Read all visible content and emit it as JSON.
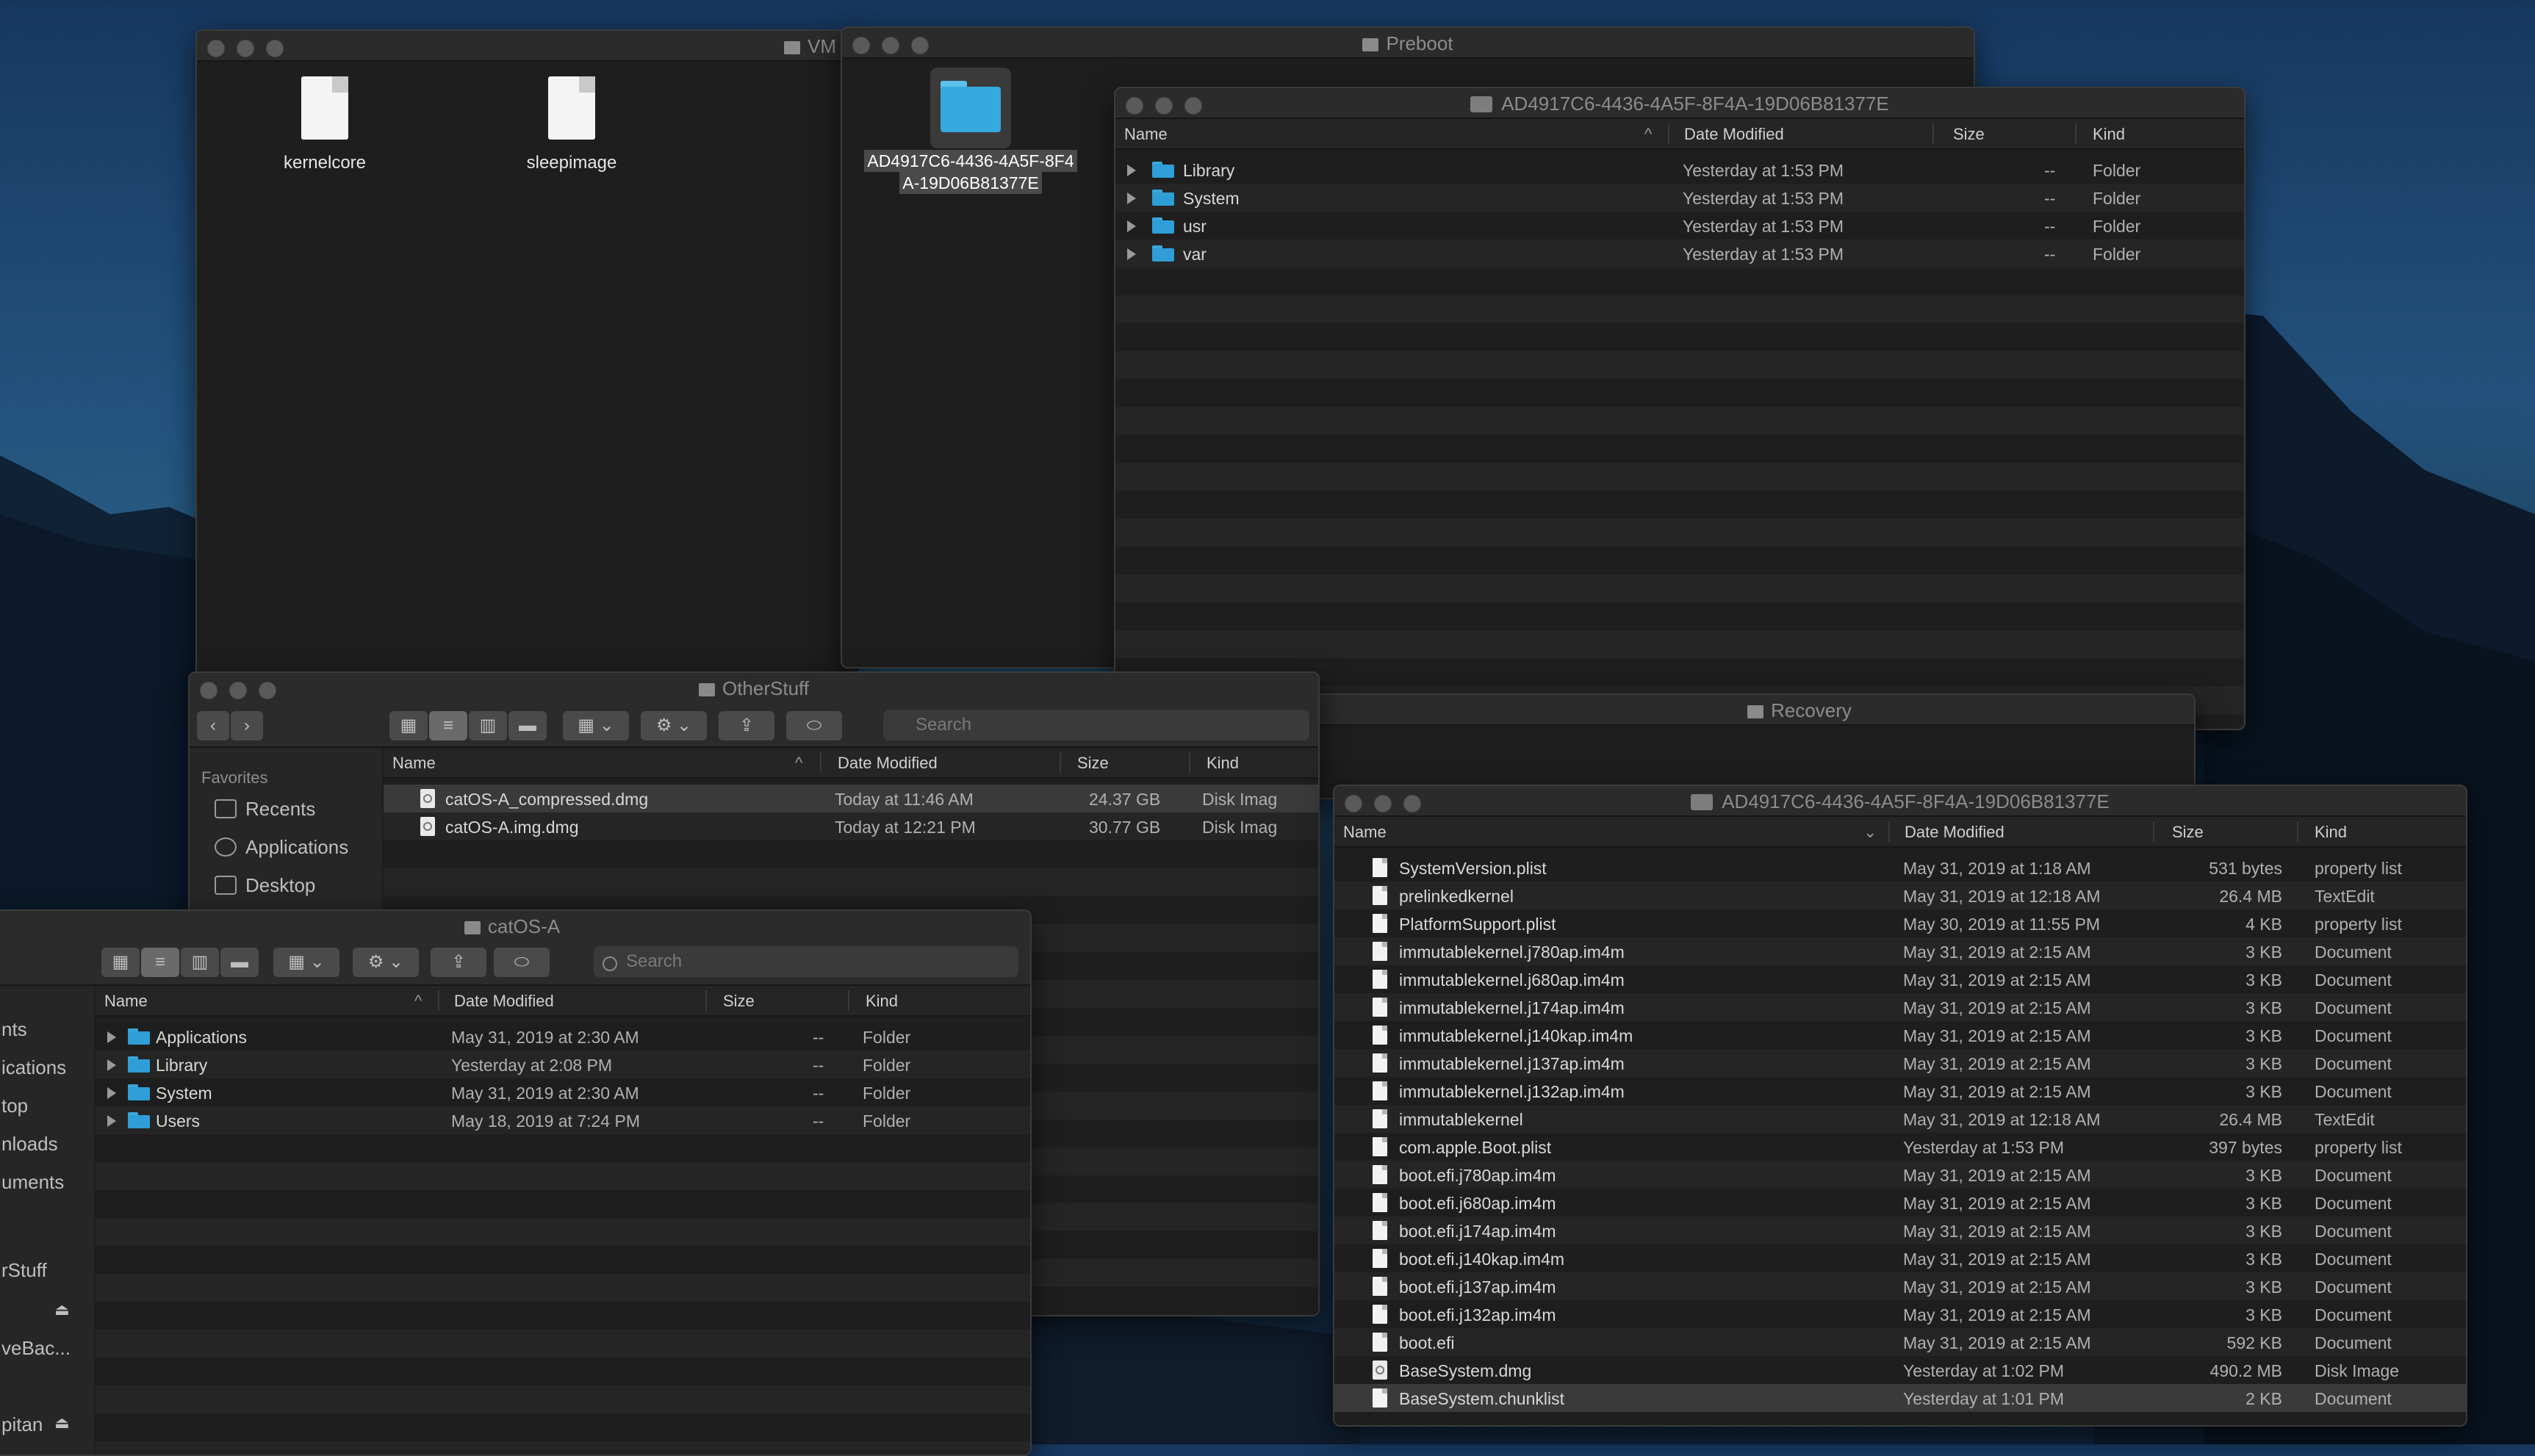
{
  "colors": {
    "folder": "#2f9ed6",
    "window_bg": "#1e1e1e",
    "titlebar": "#2b2b2b",
    "selected_row": "#3a3a3a"
  },
  "windows": {
    "vm": {
      "title": "VM",
      "icons": [
        {
          "label": "kernelcore"
        },
        {
          "label": "sleepimage"
        }
      ]
    },
    "preboot": {
      "title": "Preboot",
      "folder_label_line1": "AD4917C6-4436-4A5F-8F4",
      "folder_label_line2": "A-19D06B81377E"
    },
    "ad_top": {
      "title": "AD4917C6-4436-4A5F-8F4A-19D06B81377E",
      "columns": {
        "name": "Name",
        "date": "Date Modified",
        "size": "Size",
        "kind": "Kind"
      },
      "rows": [
        {
          "name": "Library",
          "date": "Yesterday at 1:53 PM",
          "size": "--",
          "kind": "Folder"
        },
        {
          "name": "System",
          "date": "Yesterday at 1:53 PM",
          "size": "--",
          "kind": "Folder"
        },
        {
          "name": "usr",
          "date": "Yesterday at 1:53 PM",
          "size": "--",
          "kind": "Folder"
        },
        {
          "name": "var",
          "date": "Yesterday at 1:53 PM",
          "size": "--",
          "kind": "Folder"
        }
      ]
    },
    "otherstuff": {
      "title": "OtherStuff",
      "search_placeholder": "Search",
      "sidebar": {
        "heading": "Favorites",
        "items": [
          "Recents",
          "Applications",
          "Desktop"
        ]
      },
      "columns": {
        "name": "Name",
        "date": "Date Modified",
        "size": "Size",
        "kind": "Kind"
      },
      "rows": [
        {
          "name": "catOS-A_compressed.dmg",
          "date": "Today at 11:46 AM",
          "size": "24.37 GB",
          "kind": "Disk Imag"
        },
        {
          "name": "catOS-A.img.dmg",
          "date": "Today at 12:21 PM",
          "size": "30.77 GB",
          "kind": "Disk Imag"
        }
      ]
    },
    "recovery": {
      "title": "Recovery"
    },
    "ad_bottom": {
      "title": "AD4917C6-4436-4A5F-8F4A-19D06B81377E",
      "columns": {
        "name": "Name",
        "date": "Date Modified",
        "size": "Size",
        "kind": "Kind"
      },
      "rows": [
        {
          "name": "SystemVersion.plist",
          "date": "May 31, 2019 at 1:18 AM",
          "size": "531 bytes",
          "kind": "property list"
        },
        {
          "name": "prelinkedkernel",
          "date": "May 31, 2019 at 12:18 AM",
          "size": "26.4 MB",
          "kind": "TextEdit"
        },
        {
          "name": "PlatformSupport.plist",
          "date": "May 30, 2019 at 11:55 PM",
          "size": "4 KB",
          "kind": "property list"
        },
        {
          "name": "immutablekernel.j780ap.im4m",
          "date": "May 31, 2019 at 2:15 AM",
          "size": "3 KB",
          "kind": "Document"
        },
        {
          "name": "immutablekernel.j680ap.im4m",
          "date": "May 31, 2019 at 2:15 AM",
          "size": "3 KB",
          "kind": "Document"
        },
        {
          "name": "immutablekernel.j174ap.im4m",
          "date": "May 31, 2019 at 2:15 AM",
          "size": "3 KB",
          "kind": "Document"
        },
        {
          "name": "immutablekernel.j140kap.im4m",
          "date": "May 31, 2019 at 2:15 AM",
          "size": "3 KB",
          "kind": "Document"
        },
        {
          "name": "immutablekernel.j137ap.im4m",
          "date": "May 31, 2019 at 2:15 AM",
          "size": "3 KB",
          "kind": "Document"
        },
        {
          "name": "immutablekernel.j132ap.im4m",
          "date": "May 31, 2019 at 2:15 AM",
          "size": "3 KB",
          "kind": "Document"
        },
        {
          "name": "immutablekernel",
          "date": "May 31, 2019 at 12:18 AM",
          "size": "26.4 MB",
          "kind": "TextEdit"
        },
        {
          "name": "com.apple.Boot.plist",
          "date": "Yesterday at 1:53 PM",
          "size": "397 bytes",
          "kind": "property list"
        },
        {
          "name": "boot.efi.j780ap.im4m",
          "date": "May 31, 2019 at 2:15 AM",
          "size": "3 KB",
          "kind": "Document"
        },
        {
          "name": "boot.efi.j680ap.im4m",
          "date": "May 31, 2019 at 2:15 AM",
          "size": "3 KB",
          "kind": "Document"
        },
        {
          "name": "boot.efi.j174ap.im4m",
          "date": "May 31, 2019 at 2:15 AM",
          "size": "3 KB",
          "kind": "Document"
        },
        {
          "name": "boot.efi.j140kap.im4m",
          "date": "May 31, 2019 at 2:15 AM",
          "size": "3 KB",
          "kind": "Document"
        },
        {
          "name": "boot.efi.j137ap.im4m",
          "date": "May 31, 2019 at 2:15 AM",
          "size": "3 KB",
          "kind": "Document"
        },
        {
          "name": "boot.efi.j132ap.im4m",
          "date": "May 31, 2019 at 2:15 AM",
          "size": "3 KB",
          "kind": "Document"
        },
        {
          "name": "boot.efi",
          "date": "May 31, 2019 at 2:15 AM",
          "size": "592 KB",
          "kind": "Document"
        },
        {
          "name": "BaseSystem.dmg",
          "date": "Yesterday at 1:02 PM",
          "size": "490.2 MB",
          "kind": "Disk Image"
        },
        {
          "name": "BaseSystem.chunklist",
          "date": "Yesterday at 1:01 PM",
          "size": "2 KB",
          "kind": "Document"
        }
      ]
    },
    "catos": {
      "title": "catOS-A",
      "search_placeholder": "Search",
      "sidebar_partial": [
        "nts",
        "ications",
        "top",
        "nloads",
        "uments",
        "rStuff",
        "veBac...",
        "pitan"
      ],
      "columns": {
        "name": "Name",
        "date": "Date Modified",
        "size": "Size",
        "kind": "Kind"
      },
      "rows": [
        {
          "name": "Applications",
          "date": "May 31, 2019 at 2:30 AM",
          "size": "--",
          "kind": "Folder"
        },
        {
          "name": "Library",
          "date": "Yesterday at 2:08 PM",
          "size": "--",
          "kind": "Folder"
        },
        {
          "name": "System",
          "date": "May 31, 2019 at 2:30 AM",
          "size": "--",
          "kind": "Folder"
        },
        {
          "name": "Users",
          "date": "May 18, 2019 at 7:24 PM",
          "size": "--",
          "kind": "Folder"
        }
      ]
    }
  }
}
